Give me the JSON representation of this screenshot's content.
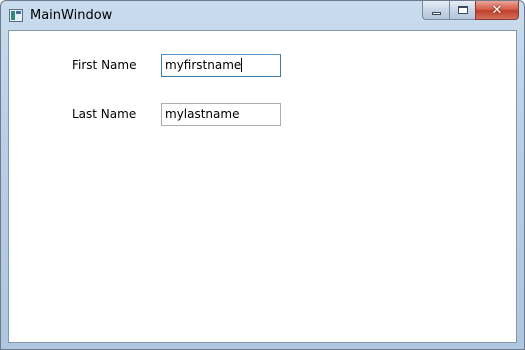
{
  "window": {
    "title": "MainWindow",
    "controls": {
      "minimize_icon": "minimize-icon",
      "maximize_icon": "maximize-icon",
      "close_icon": "close-icon",
      "close_glyph": "✕"
    }
  },
  "form": {
    "first_name": {
      "label": "First Name",
      "value": "myfirstname",
      "focused": true
    },
    "last_name": {
      "label": "Last Name",
      "value": "mylastname"
    }
  },
  "colors": {
    "titlebar": "#b9cfe6",
    "close_button": "#c0402b",
    "focus_border": "#3d7bad"
  }
}
